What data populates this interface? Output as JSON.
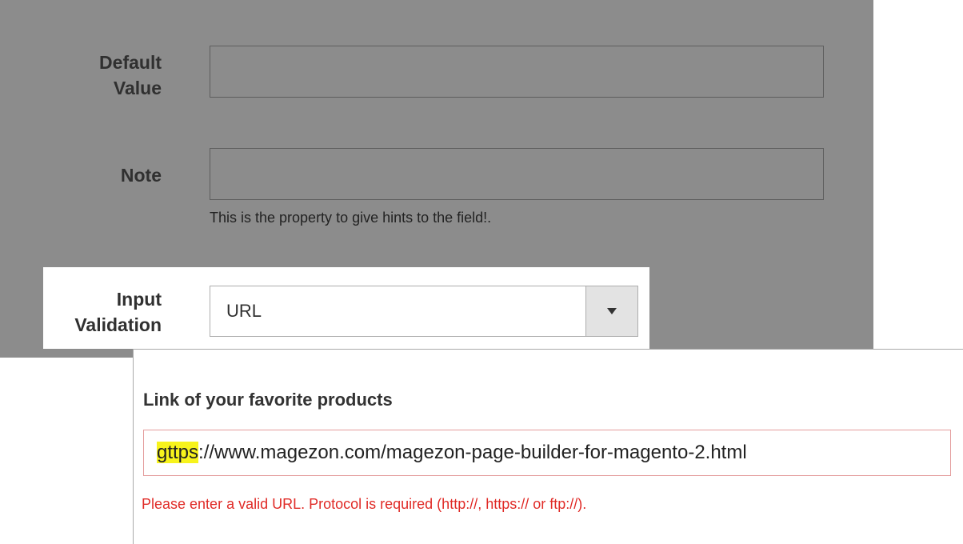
{
  "form": {
    "default_value_label_line1": "Default",
    "default_value_label_line2": "Value",
    "default_value": "",
    "note_label": "Note",
    "note_value": "",
    "note_hint": "This is the property to give hints to the field!.",
    "input_validation_label_line1": "Input",
    "input_validation_label_line2": "Validation",
    "input_validation_selected": "URL"
  },
  "frontend": {
    "field_label": "Link of your favorite products",
    "url_highlighted": "gttps",
    "url_rest": "://www.magezon.com/magezon-page-builder-for-magento-2.html",
    "error_message": "Please enter a valid URL. Protocol is required (http://, https:// or ftp://)."
  },
  "colors": {
    "overlay": "#8c8c8c",
    "error": "#e02b27",
    "highlight": "#f7f31c"
  },
  "icons": {
    "select_arrow": "caret-down-icon"
  }
}
